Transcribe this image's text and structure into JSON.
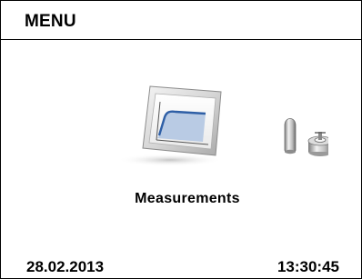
{
  "header": {
    "title": "MENU"
  },
  "menu": {
    "current_item": {
      "label": "Measurements",
      "icon": "measurements-icon"
    }
  },
  "status_bar": {
    "date": "28.02.2013",
    "time": "13:30:45"
  },
  "colors": {
    "border": "#000000",
    "background": "#ffffff",
    "chart_line": "#2e5fa6",
    "chart_fill": "#b9cbe4"
  }
}
